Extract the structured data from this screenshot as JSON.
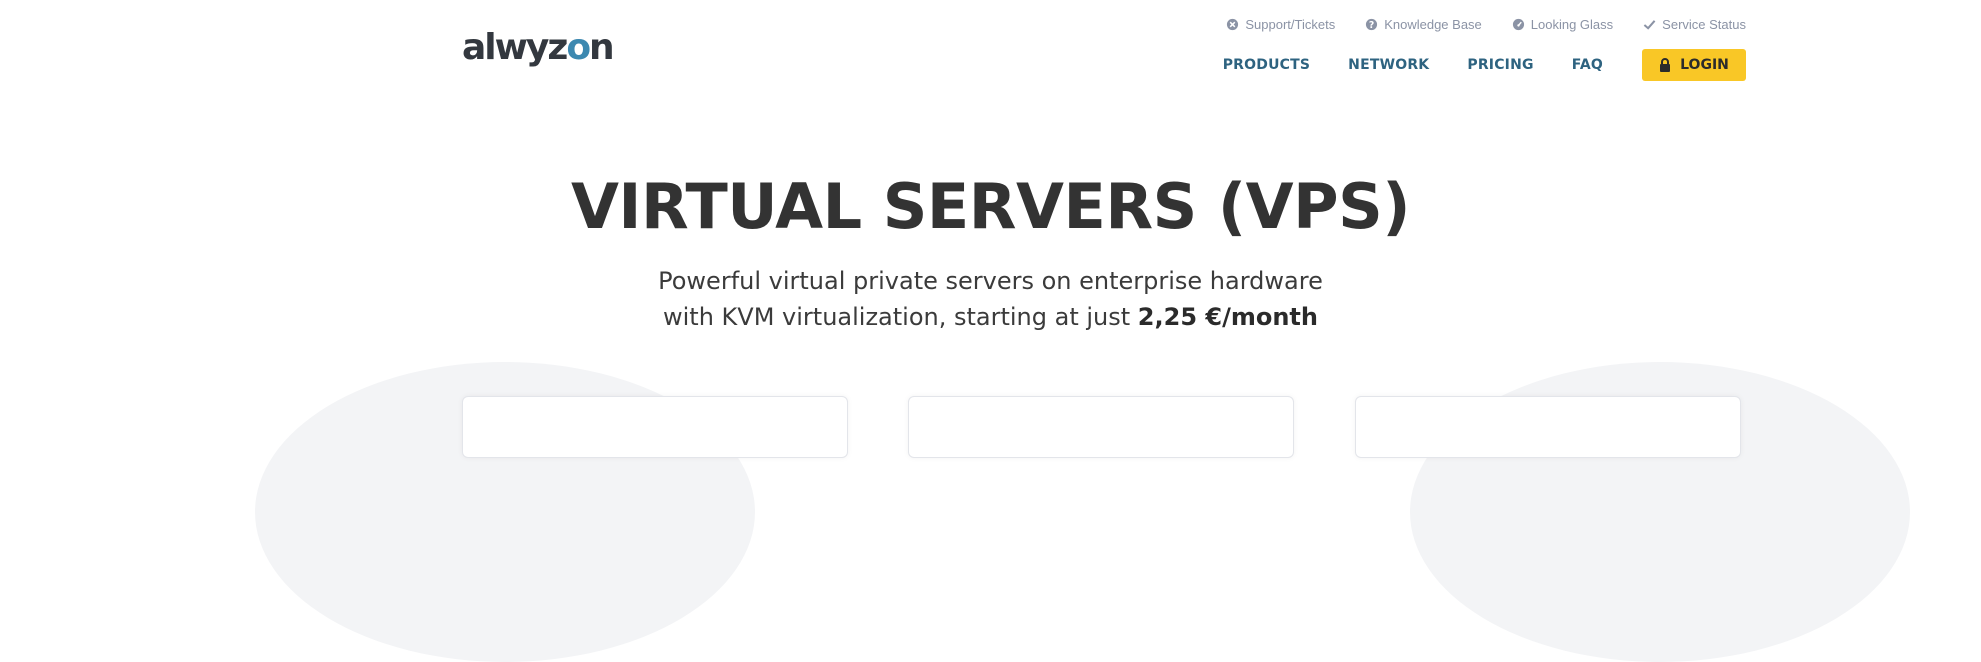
{
  "brand": {
    "logo_text_start": "alwyz",
    "logo_text_power": "o",
    "logo_text_end": "n"
  },
  "utility_nav": [
    {
      "label": "Support/Tickets",
      "icon": "support-icon"
    },
    {
      "label": "Knowledge Base",
      "icon": "question-icon"
    },
    {
      "label": "Looking Glass",
      "icon": "gauge-icon"
    },
    {
      "label": "Service Status",
      "icon": "check-icon"
    }
  ],
  "main_nav": {
    "items": [
      "PRODUCTS",
      "NETWORK",
      "PRICING",
      "FAQ"
    ],
    "login_label": "LOGIN",
    "login_icon": "lock-icon",
    "accent": "#f9c726",
    "link_color": "#2e6380"
  },
  "hero": {
    "title": "VIRTUAL SERVERS (VPS)",
    "subtitle_line1": "Powerful virtual private servers on enterprise hardware",
    "subtitle_line2_prefix": "with KVM virtualization, starting at just ",
    "subtitle_line2_price": "2,25 €/month"
  },
  "plan_cards": [
    {},
    {},
    {}
  ]
}
